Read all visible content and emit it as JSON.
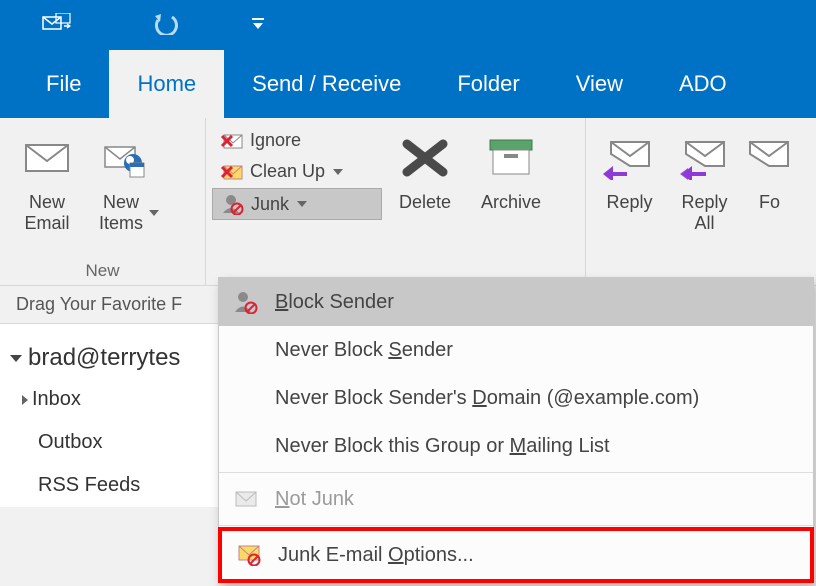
{
  "tabs": {
    "file": "File",
    "home": "Home",
    "sendreceive": "Send / Receive",
    "folder": "Folder",
    "view": "View",
    "adobe": "ADO"
  },
  "ribbon": {
    "new_group_label": "New",
    "new_email": "New Email",
    "new_items": "New Items",
    "ignore": "Ignore",
    "clean_up": "Clean Up",
    "junk": "Junk",
    "delete": "Delete",
    "archive": "Archive",
    "reply": "Reply",
    "reply_all": "Reply All",
    "forward": "Fo"
  },
  "leftpanel": {
    "favorites_hint": "Drag Your Favorite F",
    "account": "brad@terrytes",
    "inbox": "Inbox",
    "outbox": "Outbox",
    "rss": "RSS Feeds"
  },
  "junk_menu": {
    "block_sender_pre": "",
    "block_sender": "Block Sender",
    "never_block_sender": "Never Block Sender",
    "never_block_domain": "Never Block Sender's Domain (@example.com)",
    "never_block_group": "Never Block this Group or Mailing List",
    "not_junk": "Not Junk",
    "options": "Junk E-mail Options..."
  }
}
